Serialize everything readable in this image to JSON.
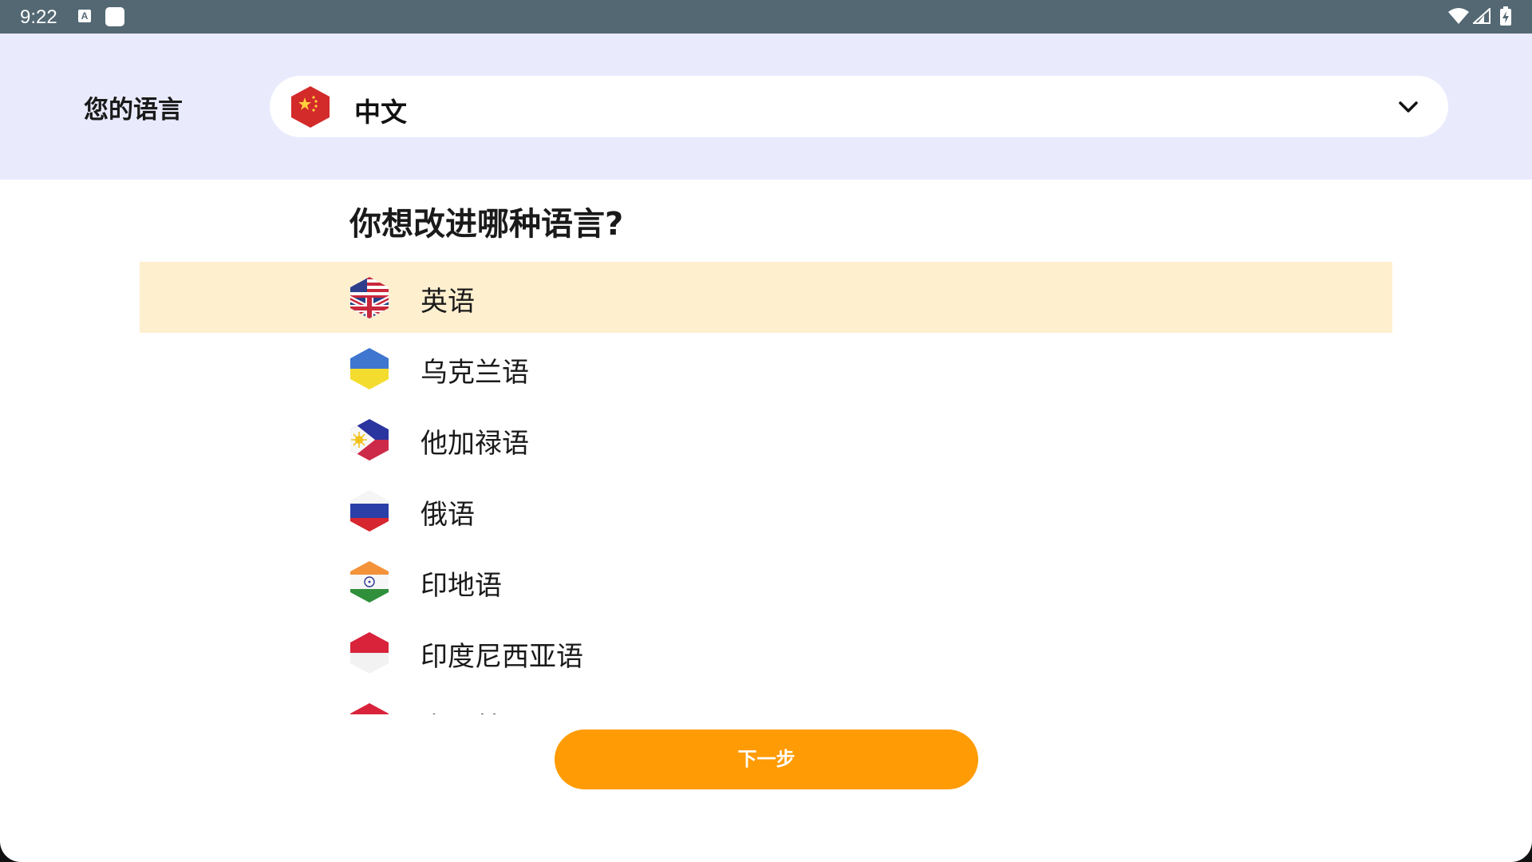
{
  "status_bar": {
    "time": "9:22",
    "notification_icon_letter": "A",
    "icons": [
      "wifi-icon",
      "cell-signal-icon",
      "battery-charging-icon"
    ]
  },
  "header": {
    "your_language_label": "您的语言",
    "selected_language": {
      "label": "中文",
      "flag": "china-flag-icon"
    },
    "dropdown_icon": "chevron-down-icon"
  },
  "question": "你想改进哪种语言?",
  "languages": [
    {
      "label": "英语",
      "flag": "us-uk-flag-icon",
      "selected": true
    },
    {
      "label": "乌克兰语",
      "flag": "ukraine-flag-icon",
      "selected": false
    },
    {
      "label": "他加禄语",
      "flag": "philippines-flag-icon",
      "selected": false
    },
    {
      "label": "俄语",
      "flag": "russia-flag-icon",
      "selected": false
    },
    {
      "label": "印地语",
      "flag": "india-flag-icon",
      "selected": false
    },
    {
      "label": "印度尼西亚语",
      "flag": "indonesia-flag-icon",
      "selected": false
    },
    {
      "label": "土耳其语",
      "flag": "turkey-flag-icon",
      "selected": false
    }
  ],
  "next_button_label": "下一步",
  "colors": {
    "status_bar": "#536873",
    "header_band": "#e9ebfd",
    "selected_row": "#feefcf",
    "primary_button": "#ff9b05"
  }
}
